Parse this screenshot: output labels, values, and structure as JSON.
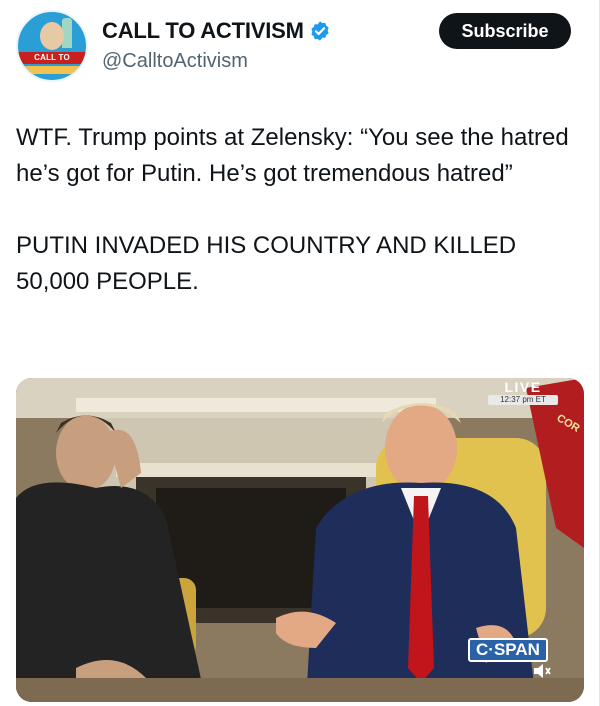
{
  "post": {
    "display_name": "CALL TO ACTIVISM",
    "handle": "@CalltoActivism",
    "subscribe_label": "Subscribe",
    "paragraphs": [
      "WTF. Trump points at Zelensky: “You see the hatred he’s got for Putin. He’s got tremendous hatred”",
      "PUTIN INVADED HIS COUNTRY AND KILLED 50,000 PEOPLE."
    ]
  },
  "avatar": {
    "banner_text": "CALL TO ACTIVISM"
  },
  "media": {
    "live_label": "LIVE",
    "time_label": "12:37 pm ET",
    "network_label": "C·SPAN",
    "mute_icon": "speaker-muted-icon"
  },
  "colors": {
    "subscribe_bg": "#0f1419",
    "verified": "#1d9bf0",
    "handle": "#536471",
    "cspan": "#2a62a8"
  }
}
